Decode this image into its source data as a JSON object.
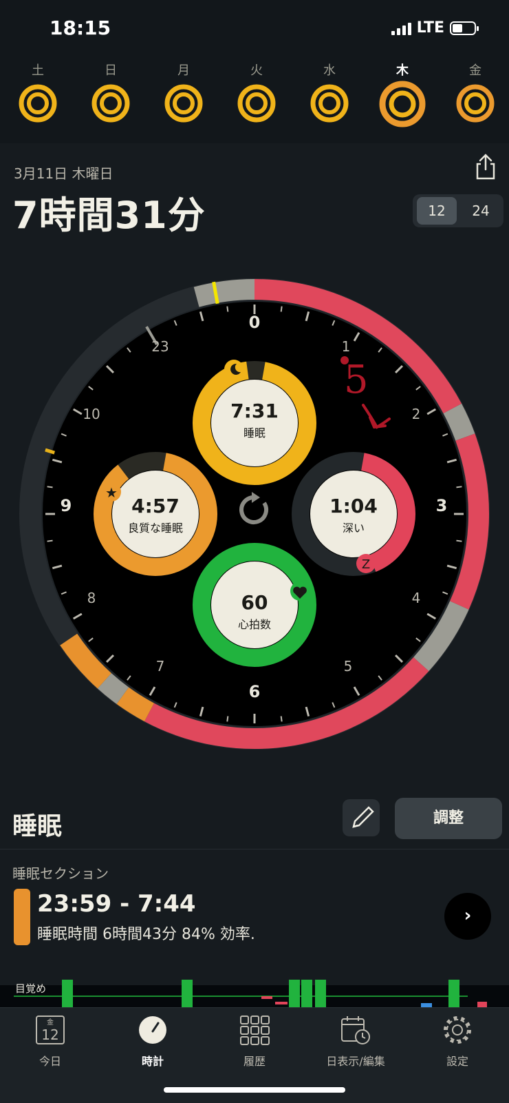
{
  "status": {
    "time": "18:15",
    "network": "LTE"
  },
  "week": {
    "days": [
      {
        "label": "土",
        "selected": false
      },
      {
        "label": "日",
        "selected": false
      },
      {
        "label": "月",
        "selected": false
      },
      {
        "label": "火",
        "selected": false
      },
      {
        "label": "水",
        "selected": false
      },
      {
        "label": "木",
        "selected": true
      },
      {
        "label": "金",
        "selected": false
      }
    ]
  },
  "header": {
    "date": "3月11日 木曜日",
    "total": "7時間31分",
    "toggle": {
      "opt12": "12",
      "opt24": "24",
      "selected": "12"
    }
  },
  "clock": {
    "hour_labels": [
      "0",
      "1",
      "2",
      "3",
      "4",
      "5",
      "6",
      "7",
      "8",
      "9",
      "10",
      "23"
    ],
    "rings": {
      "sleep": {
        "value": "7:31",
        "label": "睡眠"
      },
      "quality": {
        "value": "4:57",
        "label": "良質な睡眠"
      },
      "deep": {
        "value": "1:04",
        "label": "深い"
      },
      "heart": {
        "value": "60",
        "label": "心拍数"
      }
    },
    "annotation": "5"
  },
  "section": {
    "title": "睡眠",
    "adjust_label": "調整",
    "label": "睡眠セクション",
    "time_range": "23:59 - 7:44",
    "summary": "睡眠時間 6時間43分 84% 効率.",
    "awake_label": "目覚め"
  },
  "tabs": [
    {
      "label": "今日",
      "icon": "calendar-icon",
      "badge_top": "金",
      "badge_num": "12"
    },
    {
      "label": "時計",
      "icon": "clock-icon",
      "active": true
    },
    {
      "label": "履歴",
      "icon": "grid-icon"
    },
    {
      "label": "日表示/編集",
      "icon": "calendar-clock-icon"
    },
    {
      "label": "設定",
      "icon": "gear-icon"
    }
  ],
  "colors": {
    "sleep": "#f0b31a",
    "quality": "#eb9a2e",
    "deep": "#e2445a",
    "heart": "#21b33e",
    "cream": "#efece0"
  }
}
